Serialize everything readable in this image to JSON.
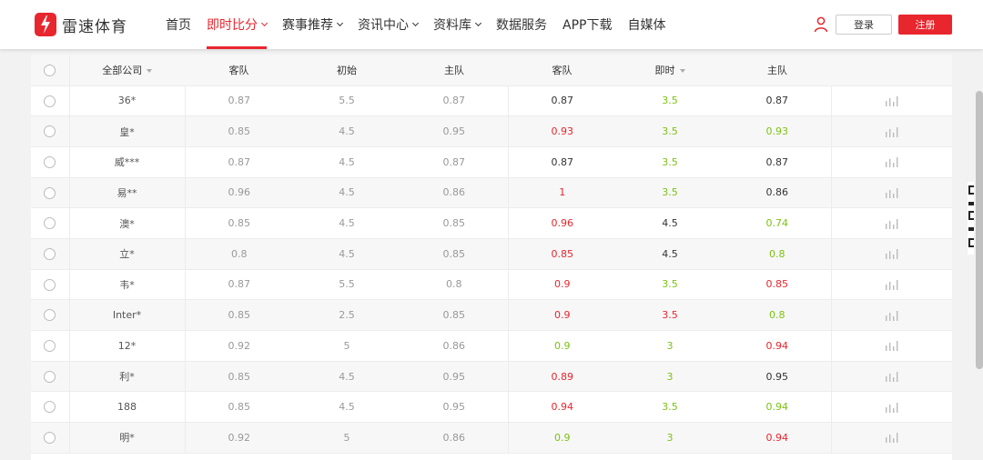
{
  "brand": {
    "name": "雷速体育",
    "color": "#e8262d"
  },
  "nav": [
    {
      "label": "首页",
      "dropdown": false,
      "active": false
    },
    {
      "label": "即时比分",
      "dropdown": true,
      "active": true
    },
    {
      "label": "赛事推荐",
      "dropdown": true,
      "active": false
    },
    {
      "label": "资讯中心",
      "dropdown": true,
      "active": false
    },
    {
      "label": "资料库",
      "dropdown": true,
      "active": false
    },
    {
      "label": "数据服务",
      "dropdown": false,
      "active": false
    },
    {
      "label": "APP下载",
      "dropdown": false,
      "active": false
    },
    {
      "label": "自媒体",
      "dropdown": false,
      "active": false
    }
  ],
  "auth": {
    "login_label": "登录",
    "register_label": "注册"
  },
  "table": {
    "headers": {
      "company": "全部公司",
      "init_away": "客队",
      "init_handicap": "初始",
      "init_home": "主队",
      "live_away": "客队",
      "live_handicap": "即时",
      "live_home": "主队"
    },
    "colors": {
      "red": "#e8262d",
      "green": "#7cc211"
    },
    "rows": [
      {
        "company": "36*",
        "init": [
          "0.87",
          "5.5",
          "0.87"
        ],
        "live": [
          {
            "v": "0.87",
            "c": "dark"
          },
          {
            "v": "3.5",
            "c": "green"
          },
          {
            "v": "0.87",
            "c": "dark"
          }
        ]
      },
      {
        "company": "皇*",
        "init": [
          "0.85",
          "4.5",
          "0.95"
        ],
        "live": [
          {
            "v": "0.93",
            "c": "red"
          },
          {
            "v": "3.5",
            "c": "green"
          },
          {
            "v": "0.93",
            "c": "green"
          }
        ]
      },
      {
        "company": "威***",
        "init": [
          "0.87",
          "4.5",
          "0.87"
        ],
        "live": [
          {
            "v": "0.87",
            "c": "dark"
          },
          {
            "v": "3.5",
            "c": "green"
          },
          {
            "v": "0.87",
            "c": "dark"
          }
        ]
      },
      {
        "company": "易**",
        "init": [
          "0.96",
          "4.5",
          "0.86"
        ],
        "live": [
          {
            "v": "1",
            "c": "red"
          },
          {
            "v": "3.5",
            "c": "green"
          },
          {
            "v": "0.86",
            "c": "dark"
          }
        ]
      },
      {
        "company": "澳*",
        "init": [
          "0.85",
          "4.5",
          "0.85"
        ],
        "live": [
          {
            "v": "0.96",
            "c": "red"
          },
          {
            "v": "4.5",
            "c": "dark"
          },
          {
            "v": "0.74",
            "c": "green"
          }
        ]
      },
      {
        "company": "立*",
        "init": [
          "0.8",
          "4.5",
          "0.85"
        ],
        "live": [
          {
            "v": "0.85",
            "c": "red"
          },
          {
            "v": "4.5",
            "c": "dark"
          },
          {
            "v": "0.8",
            "c": "green"
          }
        ]
      },
      {
        "company": "韦*",
        "init": [
          "0.87",
          "5.5",
          "0.8"
        ],
        "live": [
          {
            "v": "0.9",
            "c": "red"
          },
          {
            "v": "3.5",
            "c": "green"
          },
          {
            "v": "0.85",
            "c": "red"
          }
        ]
      },
      {
        "company": "Inter*",
        "init": [
          "0.85",
          "2.5",
          "0.85"
        ],
        "live": [
          {
            "v": "0.9",
            "c": "red"
          },
          {
            "v": "3.5",
            "c": "red"
          },
          {
            "v": "0.8",
            "c": "green"
          }
        ]
      },
      {
        "company": "12*",
        "init": [
          "0.92",
          "5",
          "0.86"
        ],
        "live": [
          {
            "v": "0.9",
            "c": "green"
          },
          {
            "v": "3",
            "c": "green"
          },
          {
            "v": "0.94",
            "c": "red"
          }
        ]
      },
      {
        "company": "利*",
        "init": [
          "0.85",
          "4.5",
          "0.95"
        ],
        "live": [
          {
            "v": "0.89",
            "c": "red"
          },
          {
            "v": "3",
            "c": "green"
          },
          {
            "v": "0.95",
            "c": "dark"
          }
        ]
      },
      {
        "company": "188",
        "init": [
          "0.85",
          "4.5",
          "0.95"
        ],
        "live": [
          {
            "v": "0.94",
            "c": "red"
          },
          {
            "v": "3.5",
            "c": "green"
          },
          {
            "v": "0.94",
            "c": "green"
          }
        ]
      },
      {
        "company": "明*",
        "init": [
          "0.92",
          "5",
          "0.86"
        ],
        "live": [
          {
            "v": "0.9",
            "c": "green"
          },
          {
            "v": "3",
            "c": "green"
          },
          {
            "v": "0.94",
            "c": "red"
          }
        ]
      }
    ]
  },
  "icons": {
    "user": "user-icon",
    "chart": "bar-chart-icon"
  }
}
